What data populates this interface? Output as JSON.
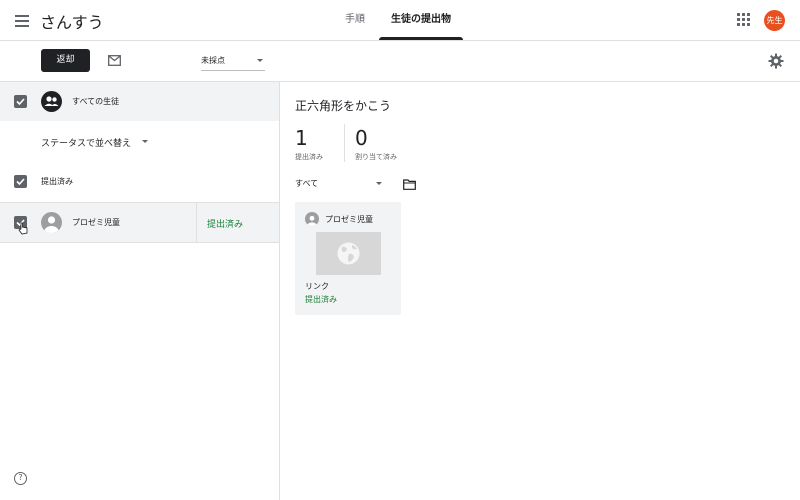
{
  "header": {
    "class_title": "さんすう",
    "tabs": [
      {
        "label": "手順",
        "active": false
      },
      {
        "label": "生徒の提出物",
        "active": true
      }
    ],
    "avatar_label": "先生",
    "avatar_color": "#e8501f"
  },
  "toolbar": {
    "return_label": "返却",
    "grade_filter_value": "未採点"
  },
  "left_panel": {
    "all_students_label": "すべての生徒",
    "sort_label": "ステータスで並べ替え",
    "group_label": "提出済み",
    "students": [
      {
        "name": "プロゼミ児童",
        "status": "提出済み",
        "checked": true
      }
    ]
  },
  "main": {
    "assignment_title": "正六角形をかこう",
    "stats": [
      {
        "count": "1",
        "label": "提出済み"
      },
      {
        "count": "0",
        "label": "割り当て済み"
      }
    ],
    "filter_value": "すべて",
    "cards": [
      {
        "student": "プロゼミ児童",
        "attachment": "リンク",
        "status": "提出済み"
      }
    ]
  },
  "colors": {
    "accent_dark": "#202124",
    "status_green": "#188038",
    "row_highlight": "#f1f3f4"
  }
}
